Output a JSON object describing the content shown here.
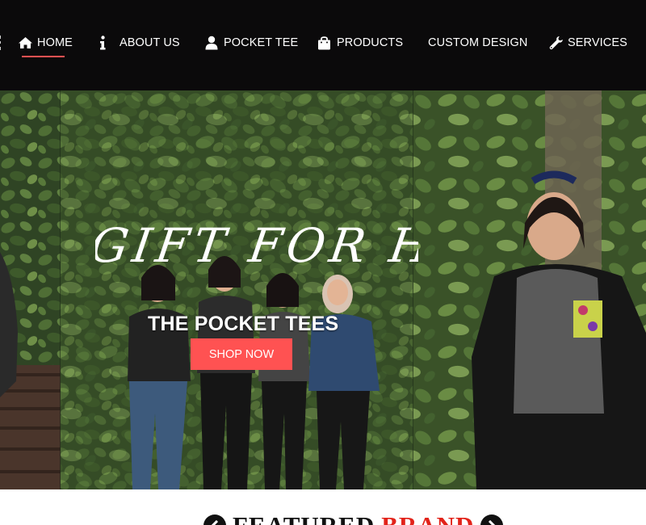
{
  "nav": {
    "items": [
      {
        "label": "HOME",
        "icon": "home-icon",
        "active": true
      },
      {
        "label": "ABOUT US",
        "icon": "info-icon"
      },
      {
        "label": "POCKET TEE",
        "icon": "user-icon"
      },
      {
        "label": "PRODUCTS",
        "icon": "shopping-bag-icon"
      },
      {
        "label": "CUSTOM DESIGN",
        "icon": ""
      },
      {
        "label": "SERVICES",
        "icon": "wrench-icon"
      }
    ]
  },
  "hero": {
    "script_title": "GIFT FOR HER",
    "title": "THE POCKET TEES",
    "button_label": "SHOP NOW"
  },
  "featured": {
    "word1": "FEATURED",
    "word2": "BRAND"
  },
  "colors": {
    "nav_bg": "#0b0a0b",
    "accent": "#ff5252",
    "featured_red": "#e2231a"
  }
}
